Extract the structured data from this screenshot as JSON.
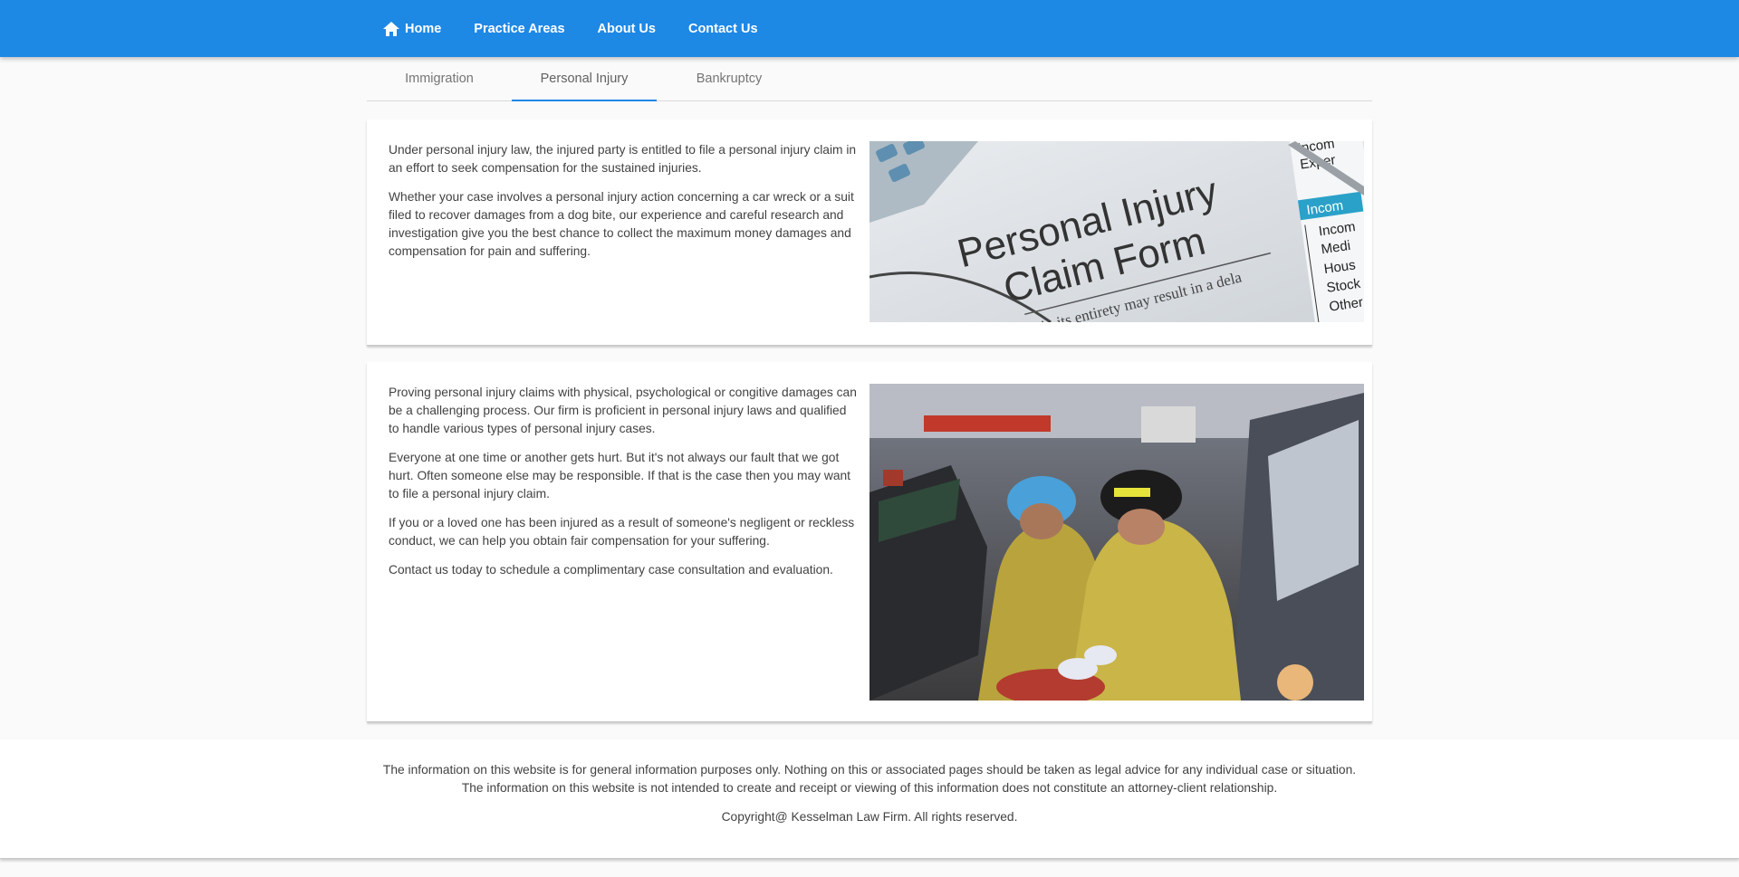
{
  "nav": {
    "home_icon": "home-icon",
    "items": [
      {
        "label": "Home"
      },
      {
        "label": "Practice Areas"
      },
      {
        "label": "About Us"
      },
      {
        "label": "Contact Us"
      }
    ]
  },
  "tabs": [
    {
      "label": "Immigration",
      "active": false
    },
    {
      "label": "Personal Injury",
      "active": true
    },
    {
      "label": "Bankruptcy",
      "active": false
    }
  ],
  "section1": {
    "paragraphs": [
      "Under personal injury law, the injured party is entitled to file a personal injury claim in an effort to seek compensation for the sustained injuries.",
      "Whether your case involves a personal injury action concerning a car wreck or a suit filed to recover damages from a dog bite, our experience and careful research and investigation give you the best chance to collect the maximum money damages and compensation for pain and suffering."
    ],
    "image": {
      "title_line1": "Personal Injury",
      "title_line2": "Claim Form",
      "subtext": "in its entirety may result in a dela",
      "list": [
        "Incom",
        "Exper",
        "Incom",
        "Incom",
        "Medi",
        "Hous",
        "Stock",
        "Other"
      ]
    }
  },
  "section2": {
    "paragraphs": [
      "Proving personal injury claims with physical, psychological or congitive damages can be a challenging process. Our firm is proficient in personal injury laws and qualified to handle various types of personal injury cases.",
      "Everyone at one time or another gets hurt. But it's not always our fault that we got hurt. Often someone else may be responsible. If that is the case then you may want to file a personal injury claim.",
      "If you or a loved one has been injured as a result of someone's negligent or reckless conduct, we can help you obtain fair compensation for your suffering.",
      "Contact us today to schedule a complimentary case consultation and evaluation."
    ]
  },
  "footer": {
    "line1": "The information on this website is for general information purposes only. Nothing on this or associated pages should be taken as legal advice for any individual case or situation.",
    "line2": "The information on this website is not intended to create and receipt or viewing of this information does not constitute an attorney-client relationship.",
    "copyright": "Copyright@ Kesselman Law Firm. All rights reserved."
  },
  "colors": {
    "nav_bg": "#1e88e5",
    "tab_indicator": "#1e88e5",
    "page_bg": "#fafafa"
  }
}
